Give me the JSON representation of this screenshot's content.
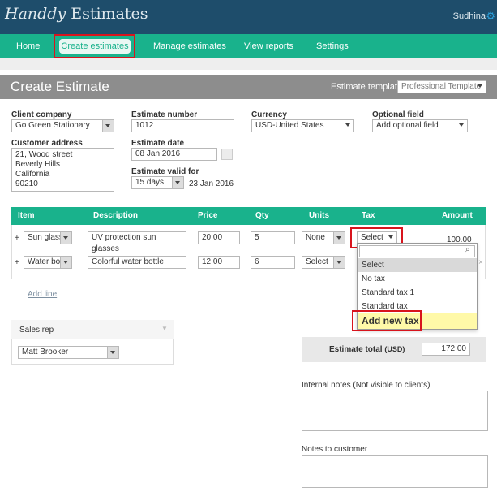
{
  "app": {
    "logo_brand": "Handdy",
    "logo_rest": "Estimates",
    "user": "Sudhina"
  },
  "nav": {
    "items": [
      "Home",
      "Create estimates",
      "Manage estimates",
      "View reports",
      "Settings"
    ],
    "active": "Create estimates"
  },
  "page": {
    "title": "Create Estimate",
    "template_label": "Estimate template",
    "template_value": "Professional Template"
  },
  "form": {
    "client_company_label": "Client company",
    "client_company_value": "Go Green Stationary",
    "customer_address_label": "Customer address",
    "customer_address_lines": [
      "21, Wood street",
      "Beverly Hills",
      "California",
      "90210"
    ],
    "estimate_number_label": "Estimate number",
    "estimate_number_value": "1012",
    "estimate_date_label": "Estimate date",
    "estimate_date_value": "08 Jan 2016",
    "valid_for_label": "Estimate valid for",
    "valid_for_value": "15 days",
    "valid_until": "23 Jan 2016",
    "currency_label": "Currency",
    "currency_value": "USD-United States",
    "optional_field_label": "Optional field",
    "optional_field_value": "Add optional field"
  },
  "table": {
    "headers": [
      "Item",
      "Description",
      "Price",
      "Qty",
      "Units",
      "Tax",
      "Amount"
    ],
    "rows": [
      {
        "item": "Sun glass",
        "description": "UV protection sun glasses",
        "price": "20.00",
        "qty": "5",
        "units": "None",
        "tax": "Select",
        "amount": "100.00"
      },
      {
        "item": "Water bot",
        "description": "Colorful water bottle",
        "price": "12.00",
        "qty": "6",
        "units": "Select",
        "tax": "",
        "amount": ""
      }
    ],
    "plus": "+",
    "add_line": "Add line"
  },
  "tax_dropdown": {
    "options": [
      "Select",
      "No tax",
      "Standard tax 1",
      "Standard tax",
      "Add new tax"
    ],
    "highlighted": "Select"
  },
  "sales_rep": {
    "label": "Sales rep",
    "value": "Matt Brooker"
  },
  "totals": {
    "label": "Estimate total",
    "currency": "(USD)",
    "value": "172.00"
  },
  "notes": {
    "internal_label": "Internal notes (Not visible to clients)",
    "customer_label": "Notes to customer"
  },
  "colors": {
    "header": "#1e4d6b",
    "nav": "#19b28c",
    "highlight": "#d8141d",
    "add_new": "#fff9a8"
  },
  "icons": [
    "gear-icon",
    "calendar-icon",
    "search-icon",
    "chevron-down-icon",
    "close-icon"
  ]
}
